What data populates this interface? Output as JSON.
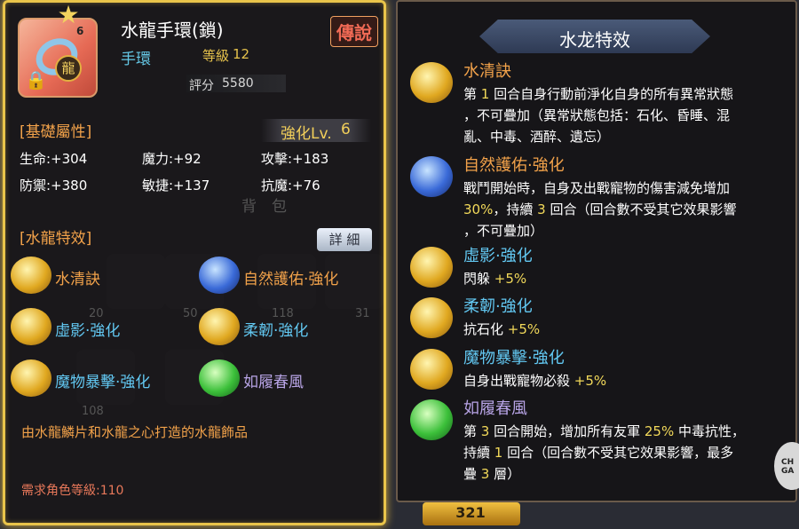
{
  "item": {
    "name": "水龍手環(鎖)",
    "rarity": "傳說",
    "type": "手環",
    "level_label": "等級",
    "level_value": "12",
    "score_label": "評分",
    "score_value": "5580",
    "star_count": "6",
    "badge_char": "龍",
    "icon": "bracelet-icon"
  },
  "base_attr": {
    "title": "[基礎屬性]",
    "enhance_label": "強化Lv.",
    "enhance_value": "6",
    "stats": [
      "生命:+304",
      "魔力:+92",
      "攻擊:+183",
      "防禦:+380",
      "敏捷:+137",
      "抗魔:+76"
    ]
  },
  "effects_left": {
    "title": "[水龍特效]",
    "detail_button": "詳 細",
    "skills": [
      {
        "name": "水清訣",
        "icon": "gold-orb-icon"
      },
      {
        "name": "自然護佑·強化",
        "icon": "blue-swirl-icon"
      },
      {
        "name": "虛影·強化",
        "icon": "gold-feather-icon"
      },
      {
        "name": "柔韌·強化",
        "icon": "gold-figure-icon"
      },
      {
        "name": "魔物暴擊·強化",
        "icon": "gold-bell-icon"
      },
      {
        "name": "如履春風",
        "icon": "green-wind-icon"
      }
    ]
  },
  "description": "由水龍鱗片和水龍之心打造的水龍飾品",
  "requirement": "需求角色等級:110",
  "background": {
    "watermark": "背　包",
    "slot_counts": [
      "20",
      "50",
      "118",
      "31",
      "108"
    ],
    "coin_count": "321",
    "logo_text": "CH\nGA"
  },
  "effects_panel": {
    "title": "水龙特效",
    "skills": [
      {
        "name": "水清訣",
        "color": "#f2a24a",
        "lines": [
          [
            "第 ",
            "1",
            " 回合自身行動前淨化自身的所有異常狀態"
          ],
          [
            "，不可疊加（異常狀態包括：石化、昏睡、混"
          ],
          [
            "亂、中毒、酒醉、遺忘）"
          ]
        ]
      },
      {
        "name": "自然護佑·強化",
        "color": "#f2a24a",
        "lines": [
          [
            "戰鬥開始時，自身及出戰寵物的傷害減免增加"
          ],
          [
            "",
            "30%",
            "，持續 ",
            "3",
            " 回合（回合數不受其它效果影響"
          ],
          [
            "，不可疊加）"
          ]
        ]
      },
      {
        "name": "虛影·強化",
        "color": "#62c8f2",
        "lines": [
          [
            "閃躲 ",
            "+5%"
          ]
        ]
      },
      {
        "name": "柔韌·強化",
        "color": "#62c8f2",
        "lines": [
          [
            "抗石化 ",
            "+5%"
          ]
        ]
      },
      {
        "name": "魔物暴擊·強化",
        "color": "#62c8f2",
        "lines": [
          [
            "自身出戰寵物必殺 ",
            "+5%"
          ]
        ]
      },
      {
        "name": "如履春風",
        "color": "#b8a4e6",
        "lines": [
          [
            "第 ",
            "3",
            " 回合開始，增加所有友軍 ",
            "25%",
            " 中毒抗性，"
          ],
          [
            "持續 ",
            "1",
            " 回合（回合數不受其它效果影響，最多"
          ],
          [
            "疊 ",
            "3",
            " 層）"
          ]
        ]
      }
    ]
  }
}
